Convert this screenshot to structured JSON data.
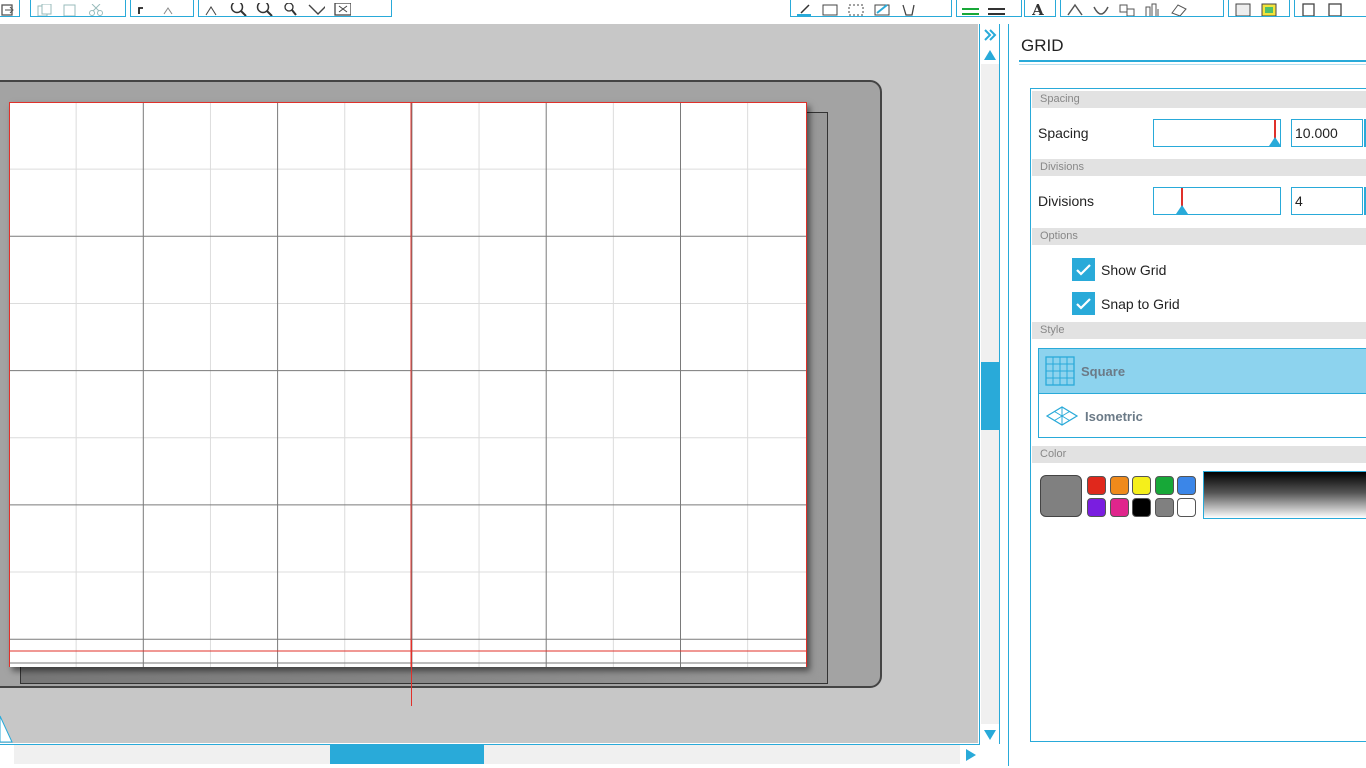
{
  "toolbar": {
    "left_groups": [
      [
        "paste-icon"
      ],
      [
        "copy-icon",
        "paste-in-place-icon",
        "cut-icon"
      ],
      [
        "undo-icon",
        "redo-icon"
      ],
      [
        "pan-icon",
        "zoom-in-icon",
        "zoom-out-icon",
        "zoom-selected-icon",
        "fit-to-page-icon",
        "fit-window-icon"
      ]
    ],
    "right_groups": [
      [
        "draw-icon",
        "rectangle-icon",
        "dotted-rectangle-icon",
        "eraser-icon",
        "knife-icon"
      ],
      [
        "line-color-icon",
        "line-style-icon"
      ],
      [
        "text-icon"
      ],
      [
        "weld-icon",
        "offset-icon",
        "replicate-icon",
        "align-icon",
        "modify-icon"
      ],
      [
        "page-settings-icon",
        "fill-color-icon"
      ],
      [
        "cut-settings-icon",
        "send-icon"
      ]
    ]
  },
  "panel": {
    "title": "GRID",
    "spacing": {
      "section": "Spacing",
      "label": "Spacing",
      "value": "10.000",
      "slider_fraction": 0.96
    },
    "divisions": {
      "section": "Divisions",
      "label": "Divisions",
      "value": "4",
      "slider_fraction": 0.22
    },
    "options": {
      "section": "Options",
      "show_grid": {
        "label": "Show Grid",
        "checked": true
      },
      "snap_to_grid": {
        "label": "Snap to Grid",
        "checked": true
      }
    },
    "style": {
      "section": "Style",
      "square_label": "Square",
      "isometric_label": "Isometric",
      "selected": "Square"
    },
    "color": {
      "section": "Color",
      "current": "#808080",
      "swatches": [
        "#e0281c",
        "#ef8a1b",
        "#f5ef1b",
        "#17a838",
        "#3b86e8",
        "#7a1ee0",
        "#e0258c",
        "#000000",
        "#808080",
        "#ffffff"
      ]
    }
  },
  "colors": {
    "accent": "#29aad9",
    "guide": "#e0302a"
  }
}
